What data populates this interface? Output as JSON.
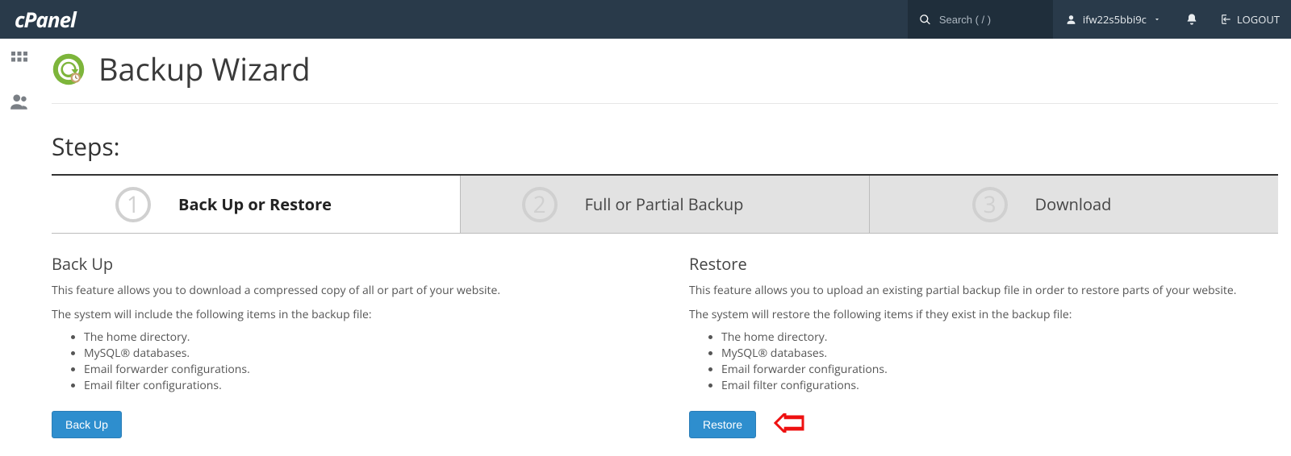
{
  "header": {
    "logo_text": "cPanel",
    "search_placeholder": "Search ( / )",
    "username": "ifw22s5bbi9c",
    "logout_label": "LOGOUT"
  },
  "page": {
    "title": "Backup Wizard",
    "steps_heading": "Steps:"
  },
  "steps": [
    {
      "num": "1",
      "label": "Back Up or Restore"
    },
    {
      "num": "2",
      "label": "Full or Partial Backup"
    },
    {
      "num": "3",
      "label": "Download"
    }
  ],
  "backup": {
    "heading": "Back Up",
    "p1": "This feature allows you to download a compressed copy of all or part of your website.",
    "p2": "The system will include the following items in the backup file:",
    "items": [
      "The home directory.",
      "MySQL® databases.",
      "Email forwarder configurations.",
      "Email filter configurations."
    ],
    "button": "Back Up"
  },
  "restore": {
    "heading": "Restore",
    "p1": "This feature allows you to upload an existing partial backup file in order to restore parts of your website.",
    "p2": "The system will restore the following items if they exist in the backup file:",
    "items": [
      "The home directory.",
      "MySQL® databases.",
      "Email forwarder configurations.",
      "Email filter configurations."
    ],
    "button": "Restore"
  }
}
